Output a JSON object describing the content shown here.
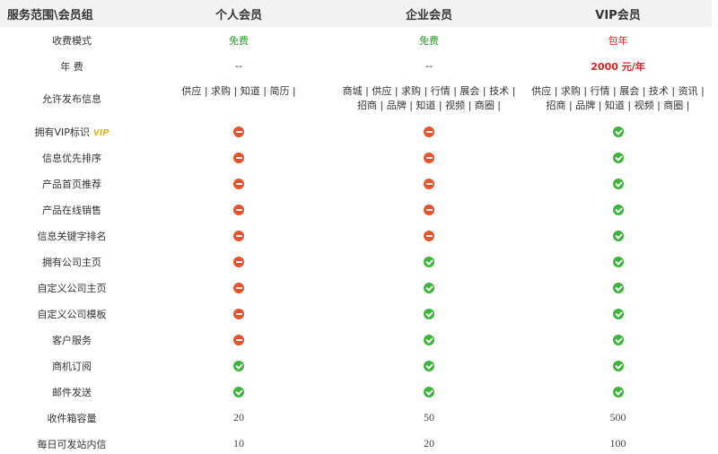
{
  "header": {
    "scope": "服务范围\\会员组",
    "col1": "个人会员",
    "col2": "企业会员",
    "col3": "VIP会员"
  },
  "rows": {
    "fee_mode": {
      "label": "收费模式",
      "v1": "免费",
      "v2": "免费",
      "v3": "包年"
    },
    "annual_fee": {
      "label": "年 费",
      "v1": "--",
      "v2": "--",
      "v3": "2000 元/年"
    },
    "publish": {
      "label": "允许发布信息",
      "v1": "供应 | 求购 | 知道 | 简历 |",
      "v2": "商城 | 供应 | 求购 | 行情 | 展会 | 技术 | 招商 | 品牌 | 知道 | 视频 | 商圈 |",
      "v3": "供应 | 求购 | 行情 | 展会 | 技术 | 资讯 | 招商 | 品牌 | 知道 | 视频 | 商圈 |"
    },
    "vip_mark": {
      "label": "拥有VIP标识",
      "badge": "VIP",
      "v1": "no",
      "v2": "no",
      "v3": "yes"
    },
    "priority": {
      "label": "信息优先排序",
      "v1": "no",
      "v2": "no",
      "v3": "yes"
    },
    "home_recommend": {
      "label": "产品首页推荐",
      "v1": "no",
      "v2": "no",
      "v3": "yes"
    },
    "online_sale": {
      "label": "产品在线销售",
      "v1": "no",
      "v2": "no",
      "v3": "yes"
    },
    "keyword_rank": {
      "label": "信息关键字排名",
      "v1": "no",
      "v2": "no",
      "v3": "yes"
    },
    "company_home": {
      "label": "拥有公司主页",
      "v1": "no",
      "v2": "yes",
      "v3": "yes"
    },
    "custom_home": {
      "label": "自定义公司主页",
      "v1": "no",
      "v2": "yes",
      "v3": "yes"
    },
    "custom_template": {
      "label": "自定义公司模板",
      "v1": "no",
      "v2": "yes",
      "v3": "yes"
    },
    "customer_service": {
      "label": "客户服务",
      "v1": "no",
      "v2": "yes",
      "v3": "yes"
    },
    "biz_subscribe": {
      "label": "商机订阅",
      "v1": "yes",
      "v2": "yes",
      "v3": "yes"
    },
    "email_send": {
      "label": "邮件发送",
      "v1": "yes",
      "v2": "yes",
      "v3": "yes"
    },
    "inbox_capacity": {
      "label": "收件箱容量",
      "v1": "20",
      "v2": "50",
      "v3": "500"
    },
    "daily_messages": {
      "label": "每日可发站内信",
      "v1": "10",
      "v2": "20",
      "v3": "100"
    }
  },
  "colors": {
    "free": "#2a9d2a",
    "paid": "#e02020",
    "header_bg": "#f2f2f2",
    "yes": "#3bb53b",
    "no": "#e8532d"
  }
}
